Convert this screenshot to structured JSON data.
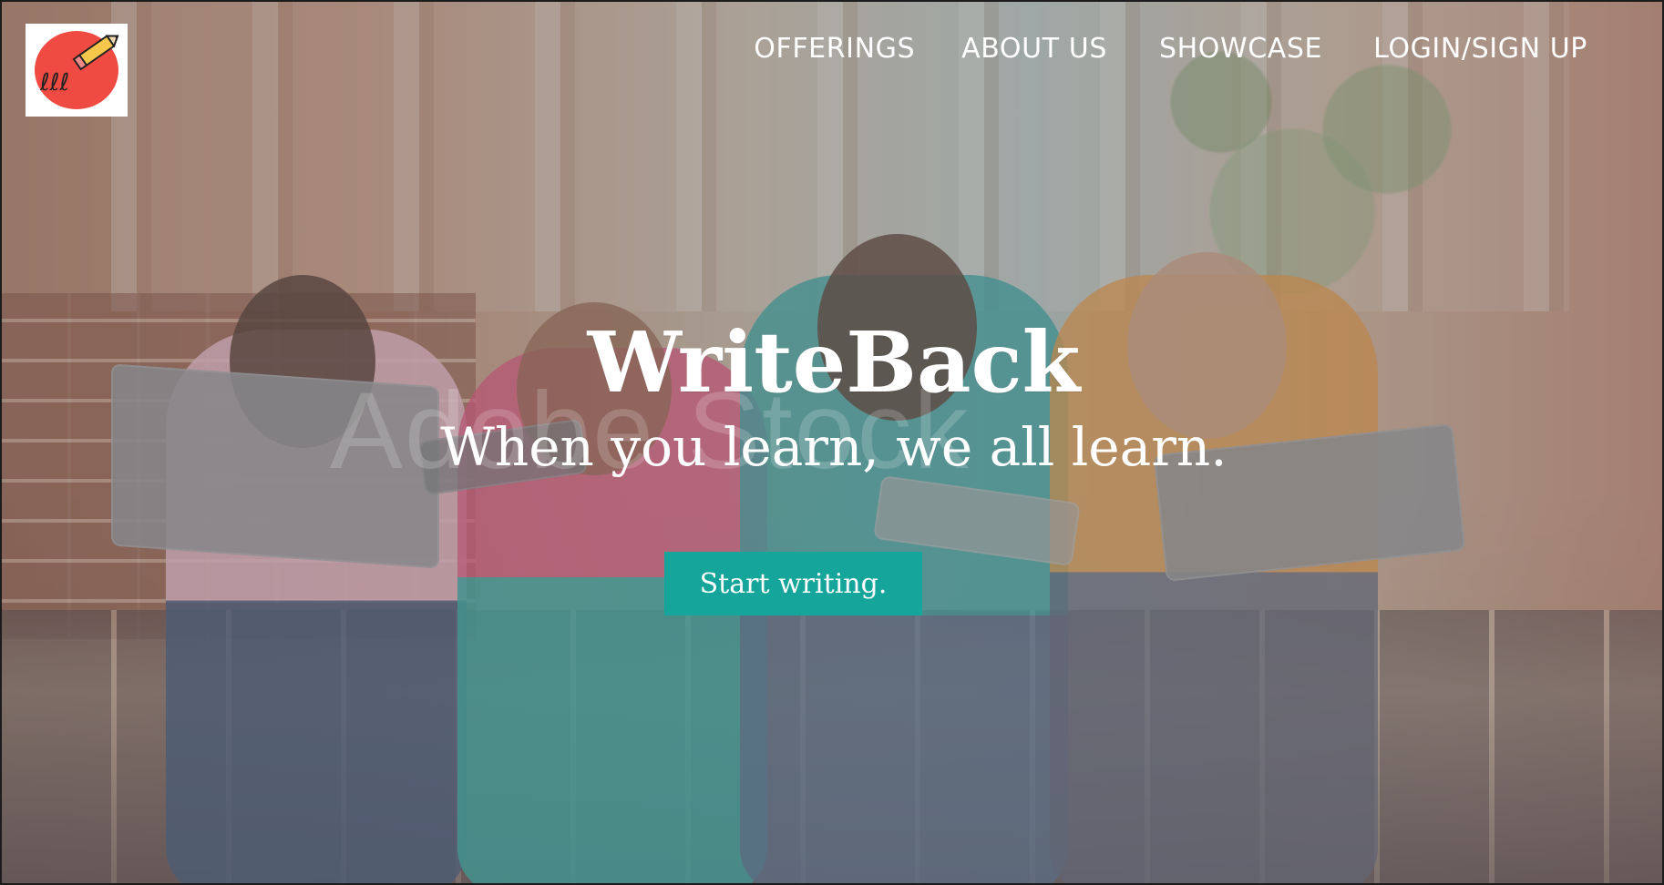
{
  "brand": {
    "logo_icon": "logo-pencil-scribble",
    "name": "WriteBack",
    "tagline": "When you learn, we all learn.",
    "watermark": "Adobe Stock"
  },
  "nav": {
    "items": [
      {
        "label": "OFFERINGS"
      },
      {
        "label": "ABOUT US"
      },
      {
        "label": "SHOWCASE"
      },
      {
        "label": "LOGIN/SIGN UP"
      }
    ]
  },
  "hero": {
    "cta_label": "Start writing.",
    "cta_color": "#16a59a",
    "logo_bg_color": "#ef4b43"
  }
}
